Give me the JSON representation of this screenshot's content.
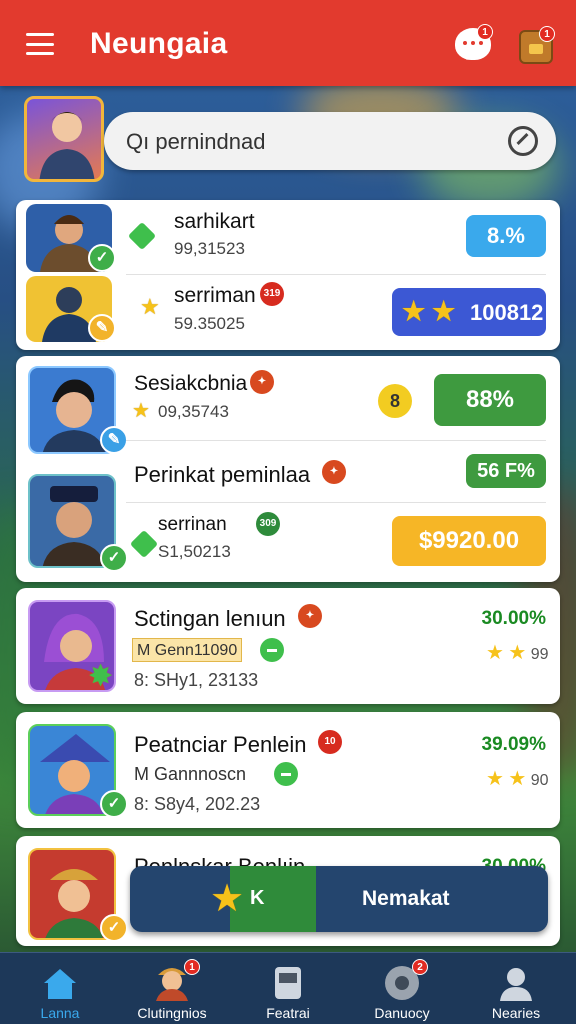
{
  "app": {
    "title": "Neungaia",
    "chat_badge": "1",
    "bag_badge": "1"
  },
  "search": {
    "value": "Qı pernindnad"
  },
  "players": [
    {
      "name": "sarhikart",
      "score": "99,31523",
      "value": "8.%",
      "value_color": "#3aa9ec"
    },
    {
      "name": "serriman",
      "badge": "319",
      "score": "59.35025",
      "value": "100812",
      "value_color": "#3c58d4"
    },
    {
      "name": "Sesiakcbnia",
      "score": "09,35743",
      "coin_label": "8",
      "value": "88%",
      "value_color": "#3e9a3f"
    },
    {
      "name": "Perinkat peminlaa",
      "value": "56 F%",
      "value_color": "#3e9a3f"
    },
    {
      "name": "serrinan",
      "badge": "309",
      "score": "S1,50213",
      "value": "$9920.00",
      "value_color": "#f6b626"
    },
    {
      "name": "Sctingan lenıun",
      "tag": "M Genn11090",
      "score": "8: SHy1, 23133",
      "pct": "30.00%",
      "rating": "99"
    },
    {
      "name": "Peatnciar Penlein",
      "badge": "10",
      "tag": "M Gannnoscn",
      "score": "8: S8y4, 202.23",
      "pct": "39.09%",
      "rating": "90"
    },
    {
      "name": "Penlnskar Benlıin",
      "pct": "30.00%"
    }
  ],
  "cta": {
    "left_label": "K",
    "label": "Nemakat"
  },
  "nav": [
    {
      "label": "Lanna",
      "icon": "home-icon"
    },
    {
      "label": "Clutingnios",
      "icon": "character-icon",
      "badge": "1"
    },
    {
      "label": "Featrai",
      "icon": "device-icon"
    },
    {
      "label": "Danuocy",
      "icon": "settings-icon",
      "badge": "2"
    },
    {
      "label": "Nearies",
      "icon": "profile-icon"
    }
  ]
}
